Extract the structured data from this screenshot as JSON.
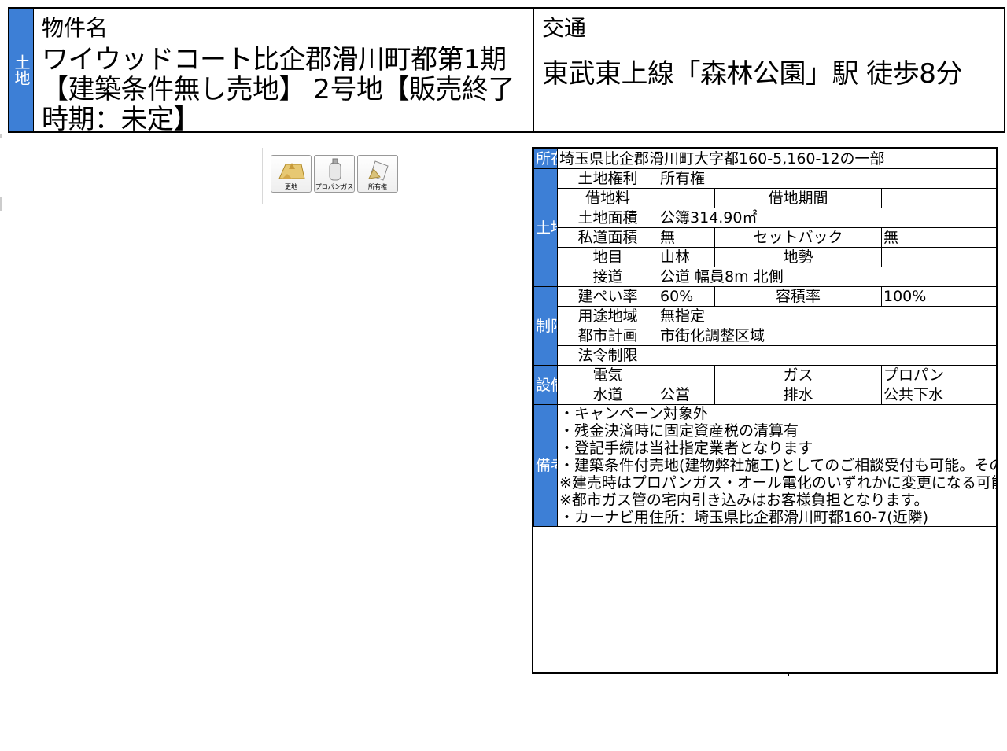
{
  "header": {
    "tag": "土地",
    "name_label": "物件名",
    "name_value": "ワイウッドコート比企郡滑川町都第1期【建築条件無し売地】 2号地【販売終了時期：未定】",
    "access_label": "交通",
    "access_value": "東武東上線「森林公園」駅 徒歩8分"
  },
  "icons": [
    {
      "name": "更地",
      "icon": "vacant-land-icon"
    },
    {
      "name": "プロパンガス",
      "icon": "propane-gas-icon"
    },
    {
      "name": "所有権",
      "icon": "ownership-icon"
    }
  ],
  "details": {
    "location_side": "所在",
    "location": "埼玉県比企郡滑川町大字都160-5,160-12の一部",
    "land_side": "土地",
    "land_right_label": "土地権利",
    "land_right": "所有権",
    "rent_label": "借地料",
    "rent": "",
    "lease_period_label": "借地期間",
    "lease_period": "",
    "area_label": "土地面積",
    "area": "公簿314.90㎡",
    "private_road_label": "私道面積",
    "private_road": "無",
    "setback_label": "セットバック",
    "setback": "無",
    "category_label": "地目",
    "category": "山林",
    "terrain_label": "地勢",
    "terrain": "",
    "road_label": "接道",
    "road": "公道 幅員8m 北側",
    "restrict_side": "制限",
    "coverage_label": "建ぺい率",
    "coverage": "60%",
    "far_label": "容積率",
    "far": "100%",
    "zoning_label": "用途地域",
    "zoning": "無指定",
    "city_plan_label": "都市計画",
    "city_plan": "市街化調整区域",
    "legal_label": "法令制限",
    "legal": "",
    "facility_side": "設備",
    "electric_label": "電気",
    "electric": "",
    "gas_label": "ガス",
    "gas": "プロパン",
    "water_label": "水道",
    "water": "公営",
    "drain_label": "排水",
    "drain": "公共下水",
    "notes_side": "備考",
    "notes": [
      "・キャンペーン対象外",
      "・残金決済時に固定資産税の清算有",
      "・登記手続は当社指定業者となります",
      "・建築条件付売地(建物弊社施工)としてのご相談受付も可能。その際仲介手数料とは別途でご紹介いただいた仲介業者様へ紹介料のお支払いをいたします。(紹介料については要相談)",
      "※建売時はプロパンガス・オール電化のいずれかに変更になる可能性がございます。",
      "※都市ガス管の宅内引き込みはお客様負担となります。",
      "・カーナビ用住所：埼玉県比企郡滑川町都160-7(近隣)"
    ]
  }
}
